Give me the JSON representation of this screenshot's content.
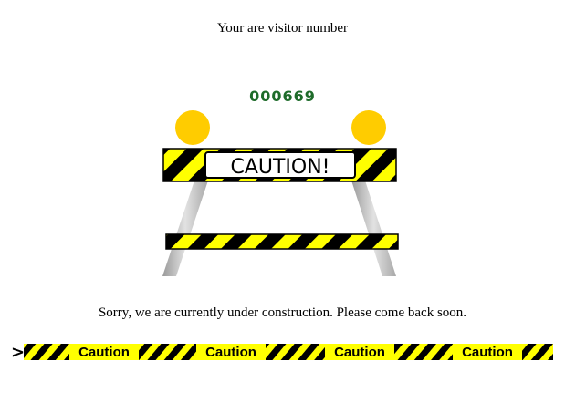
{
  "visitor": {
    "text": "Your are visitor number",
    "count": "000669"
  },
  "barricade": {
    "sign_text": "CAUTION!"
  },
  "message": {
    "text": "Sorry, we are currently under construction. Please come back soon."
  },
  "tape": {
    "arrow": ">",
    "labels": [
      "Caution",
      "Caution",
      "Caution",
      "Caution"
    ]
  },
  "colors": {
    "stripe_yellow": "#ffff00",
    "stripe_black": "#000000",
    "lamp": "#ffcc00",
    "counter_green": "#1e6b2a",
    "leg_gray": "#bdbdbd"
  }
}
